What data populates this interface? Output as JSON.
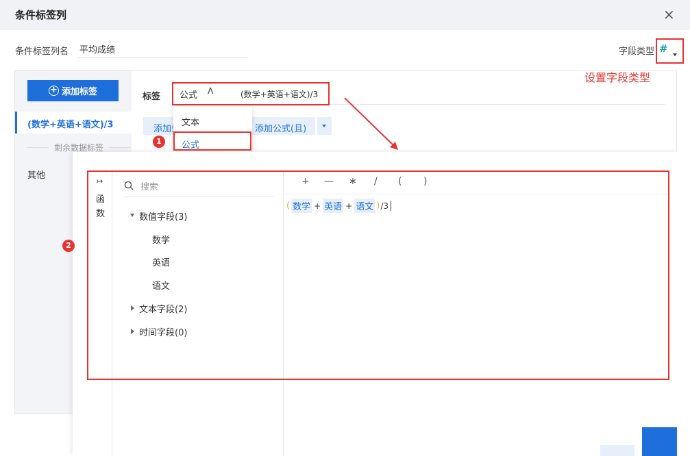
{
  "dialog": {
    "title": "条件标签列",
    "close_glyph": "×"
  },
  "column_name": {
    "label": "条件标签列名",
    "value": "平均成绩"
  },
  "field_type": {
    "label": "字段类型",
    "icon": "#",
    "note": "设置字段类型"
  },
  "sidebar": {
    "add_button": "添加标签",
    "active_tag": "(数学+英语+语文)/3",
    "remaining_label": "剩余数据标签",
    "other_item": "其他"
  },
  "tag_row": {
    "label": "标签",
    "selected_type": "公式",
    "chevron": "ᐱ",
    "formula_preview": "(数学+英语+语文)/3"
  },
  "dropdown": {
    "options": [
      "文本",
      "公式"
    ]
  },
  "actions": {
    "add_left_partial": "添加条",
    "add_formula": "添加公式(且)"
  },
  "markers": [
    "1",
    "2"
  ],
  "editor": {
    "func_label": "函数",
    "search_placeholder": "搜索",
    "tree": [
      {
        "label": "数值字段(3)",
        "expanded": true,
        "children": [
          "数学",
          "英语",
          "语文"
        ]
      },
      {
        "label": "文本字段(2)",
        "expanded": false
      },
      {
        "label": "时间字段(0)",
        "expanded": false
      }
    ],
    "operators": [
      "+",
      "—",
      "∗",
      "/",
      "(",
      ")"
    ],
    "formula": {
      "open": "(",
      "chips": [
        "数学",
        "英语",
        "语文"
      ],
      "plus": "+",
      "close": ")",
      "tail": "/3"
    }
  },
  "colors": {
    "primary": "#1e6fdc",
    "highlight": "#e8322f",
    "paren": "#e6b23a",
    "hash_icon": "#1aa29d"
  }
}
